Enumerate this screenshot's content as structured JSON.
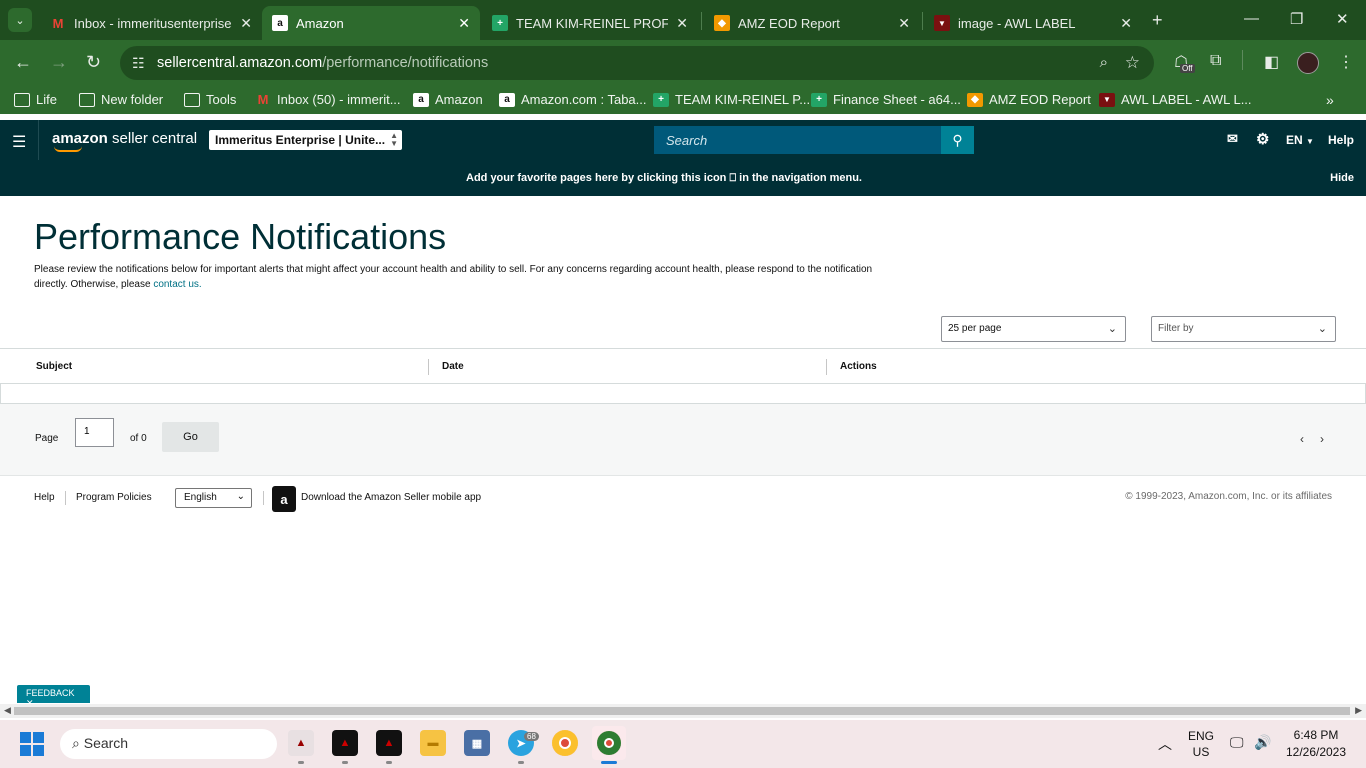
{
  "browser": {
    "tabs": [
      {
        "title": "Inbox - immeritusenterprises",
        "favicon": "gmail-icon"
      },
      {
        "title": "Amazon",
        "favicon": "amazon-icon",
        "active": true
      },
      {
        "title": "TEAM KIM-REINEL PROFIT S",
        "favicon": "sheets-icon"
      },
      {
        "title": "AMZ EOD Report",
        "favicon": "report-icon"
      },
      {
        "title": "image - AWL LABEL",
        "favicon": "awl-icon"
      }
    ],
    "url_host": "sellercentral.amazon.com",
    "url_path": "/performance/notifications",
    "extension_badge": "Off",
    "bookmarks": [
      {
        "label": "Life",
        "icon": "folder-icon"
      },
      {
        "label": "New folder",
        "icon": "folder-icon"
      },
      {
        "label": "Tools",
        "icon": "folder-icon"
      },
      {
        "label": "Inbox (50) - immerit...",
        "icon": "gmail-icon"
      },
      {
        "label": "Amazon",
        "icon": "amazon-icon"
      },
      {
        "label": "Amazon.com : Taba...",
        "icon": "amazon-icon"
      },
      {
        "label": "TEAM KIM-REINEL P...",
        "icon": "sheets-icon"
      },
      {
        "label": "Finance Sheet - a64...",
        "icon": "sheets-icon"
      },
      {
        "label": "AMZ EOD Report",
        "icon": "report-icon"
      },
      {
        "label": "AWL LABEL - AWL L...",
        "icon": "awl-icon"
      }
    ]
  },
  "header": {
    "logo_bold": "amazon",
    "logo_rest": " seller central",
    "account": "Immeritus Enterprise | Unite...",
    "search_placeholder": "Search",
    "lang": "EN",
    "help": "Help",
    "banner_pre": "Add your favorite pages here by clicking this icon",
    "banner_post": "in the navigation menu.",
    "hide": "Hide"
  },
  "main": {
    "title": "Performance Notifications",
    "intro": "Please review the notifications below for important alerts that might affect your account health and ability to sell. For any concerns regarding account health, please respond to the notification directly. Otherwise, please",
    "contact_link": "contact us.",
    "per_page": "25 per page",
    "filter": "Filter by",
    "columns": [
      "Subject",
      "Date",
      "Actions"
    ],
    "page_label": "Page",
    "page_value": "1",
    "of_label": "of 0",
    "go": "Go"
  },
  "footer": {
    "help": "Help",
    "policies": "Program Policies",
    "language": "English",
    "app": "Download the Amazon Seller mobile app",
    "copyright": "© 1999-2023, Amazon.com, Inc. or its affiliates"
  },
  "feedback": "FEEDBACK",
  "taskbar": {
    "search": "Search",
    "telegram_badge": "68",
    "lang_top": "ENG",
    "lang_bottom": "US",
    "time": "6:48 PM",
    "date": "12/26/2023"
  },
  "colors": {
    "chrome_dark": "#1f4d1f",
    "chrome": "#2d6a2d",
    "sc_header": "#002f36",
    "accent": "#008296"
  }
}
